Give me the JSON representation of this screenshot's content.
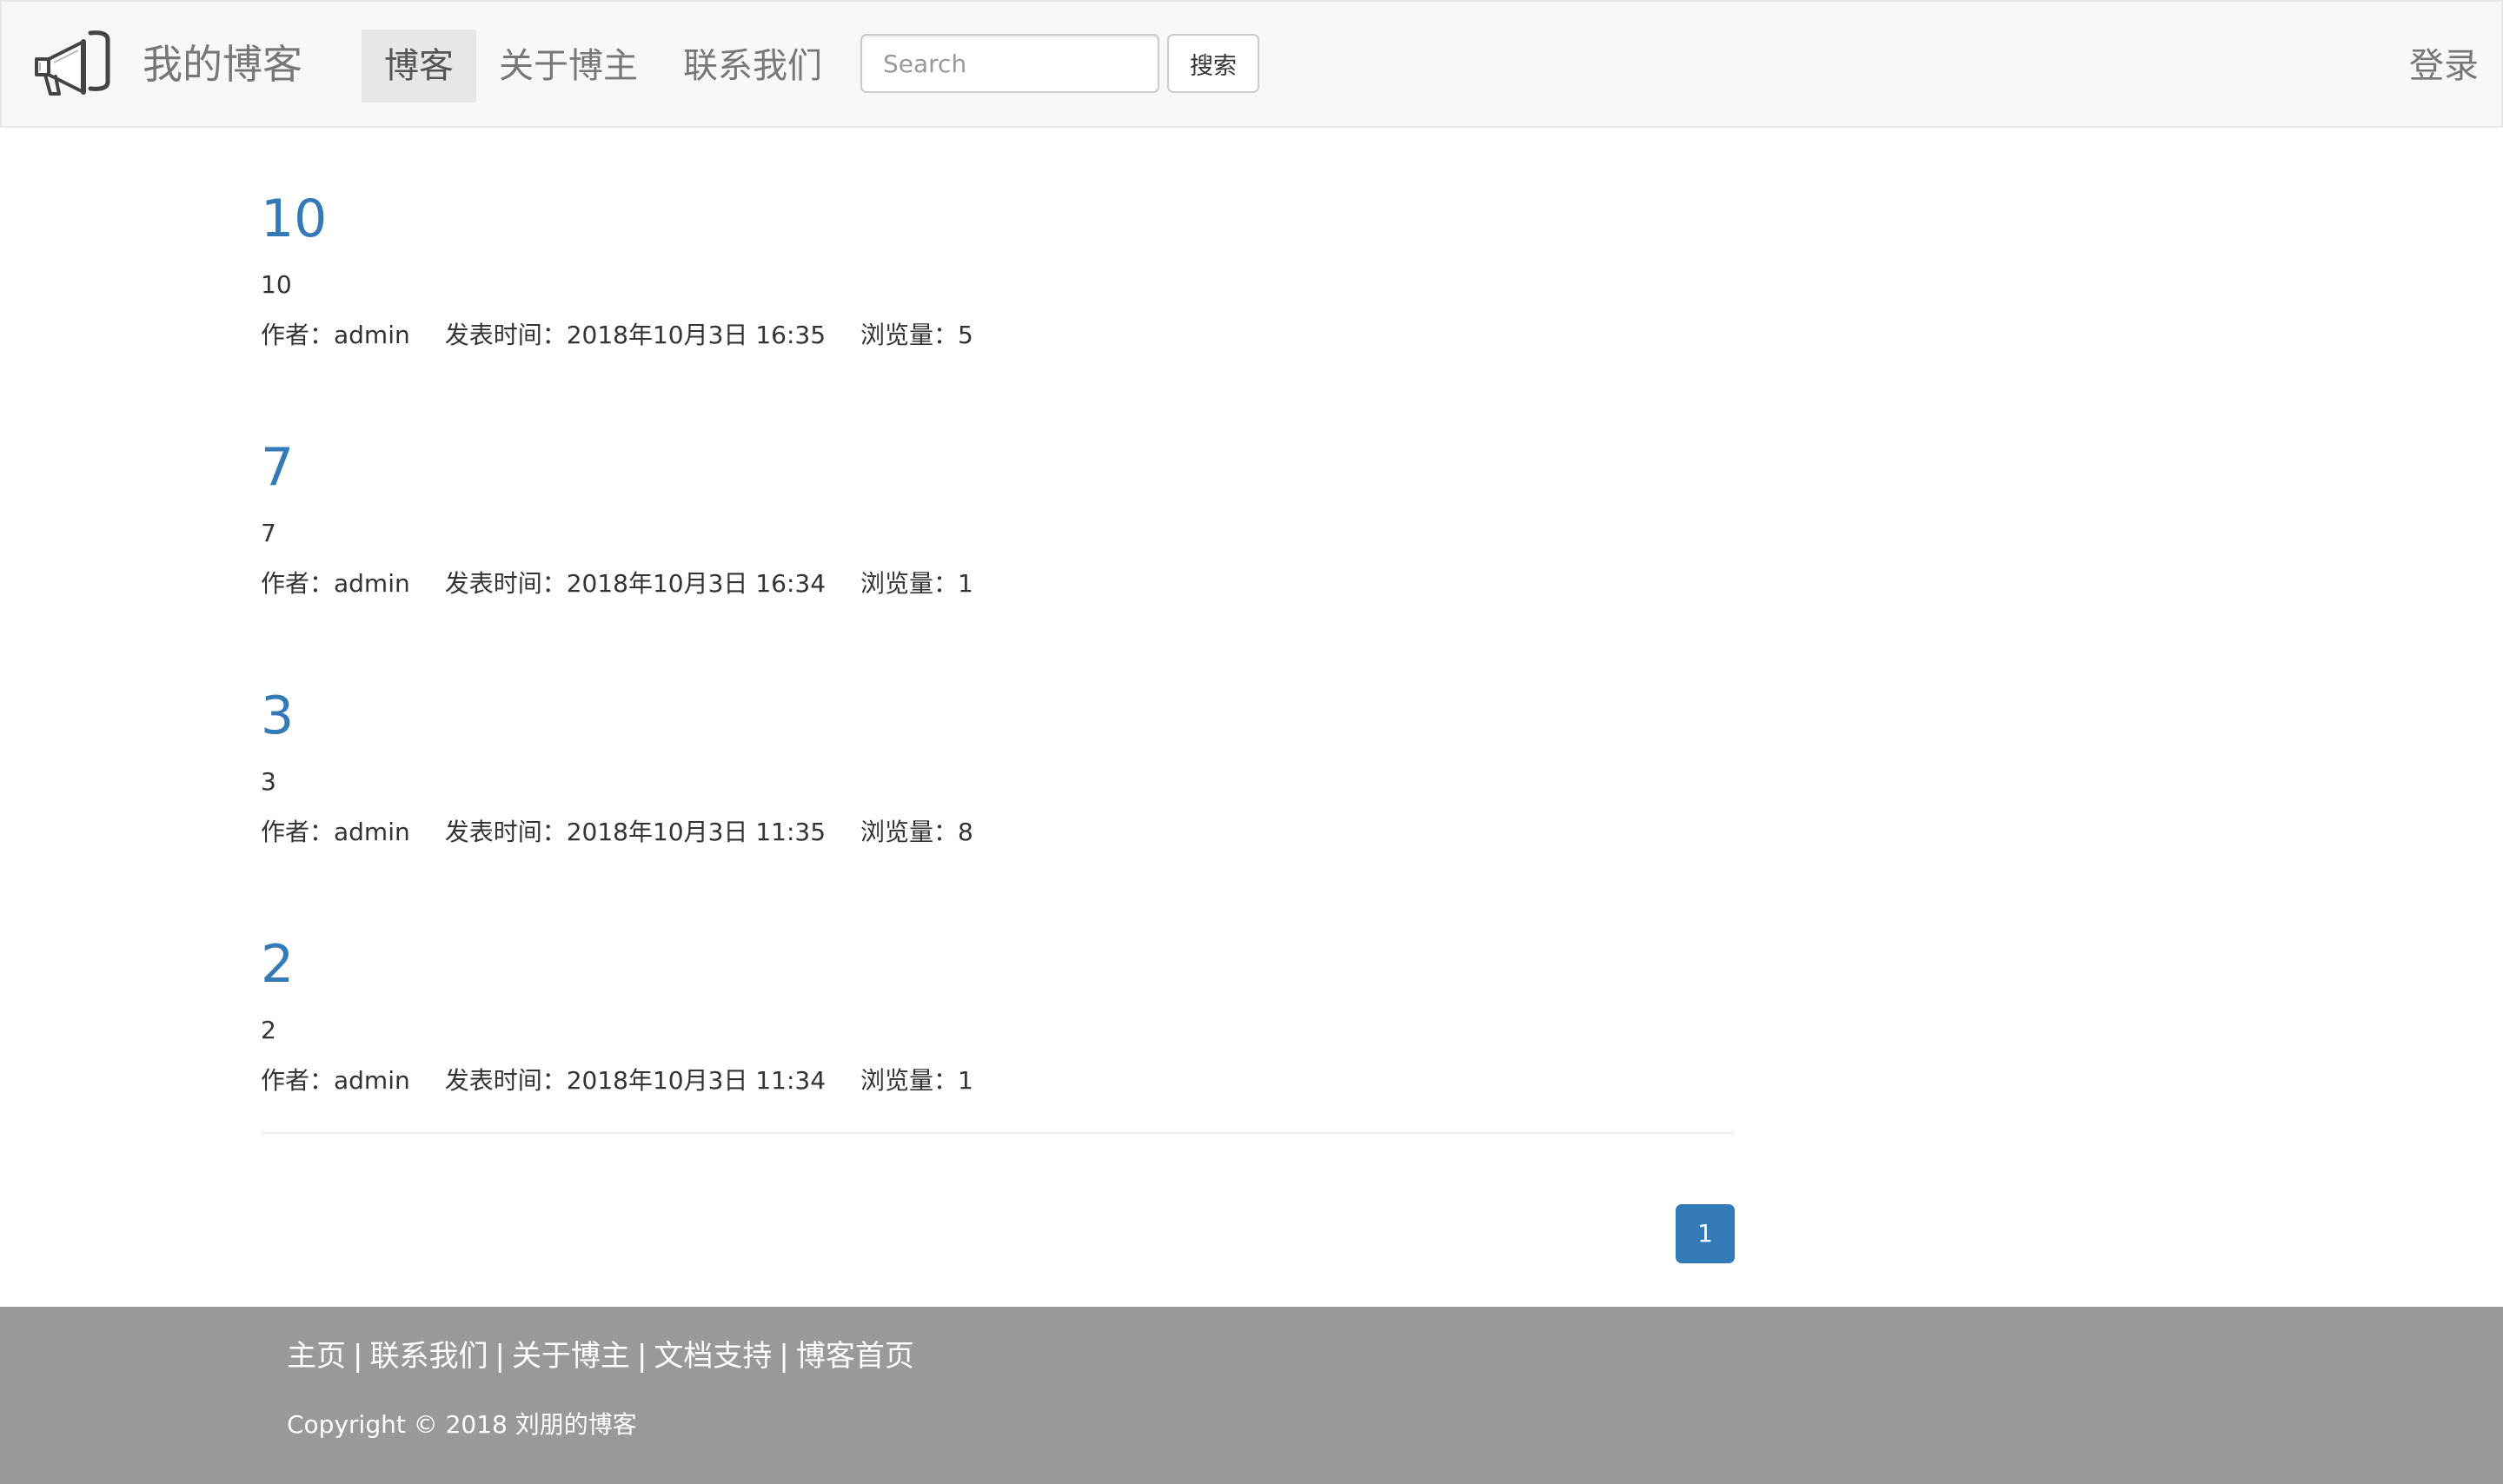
{
  "navbar": {
    "brand_icon": "megaphone-icon",
    "brand_title": "我的博客",
    "tabs": [
      {
        "label": "博客",
        "active": true
      },
      {
        "label": "关于博主",
        "active": false
      },
      {
        "label": "联系我们",
        "active": false
      }
    ],
    "search": {
      "placeholder": "Search",
      "value": ""
    },
    "search_button": "搜索",
    "login": "登录"
  },
  "posts": [
    {
      "title": "10",
      "summary": "10",
      "author": "作者：admin",
      "published": "发表时间：2018年10月3日 16:35",
      "views": "浏览量：5"
    },
    {
      "title": "7",
      "summary": "7",
      "author": "作者：admin",
      "published": "发表时间：2018年10月3日 16:34",
      "views": "浏览量：1"
    },
    {
      "title": "3",
      "summary": "3",
      "author": "作者：admin",
      "published": "发表时间：2018年10月3日 11:35",
      "views": "浏览量：8"
    },
    {
      "title": "2",
      "summary": "2",
      "author": "作者：admin",
      "published": "发表时间：2018年10月3日 11:34",
      "views": "浏览量：1"
    }
  ],
  "pagination": {
    "current_page": "1"
  },
  "footer": {
    "links": [
      "主页",
      "联系我们",
      "关于博主",
      "文档支持",
      "博客首页"
    ],
    "separator": "|",
    "copyright": "Copyright © 2018 刘朋的博客"
  },
  "colors": {
    "link_blue": "#337ab7",
    "navbar_bg": "#f8f8f8",
    "active_tab_bg": "#e7e7e7",
    "footer_bg": "#999999"
  }
}
